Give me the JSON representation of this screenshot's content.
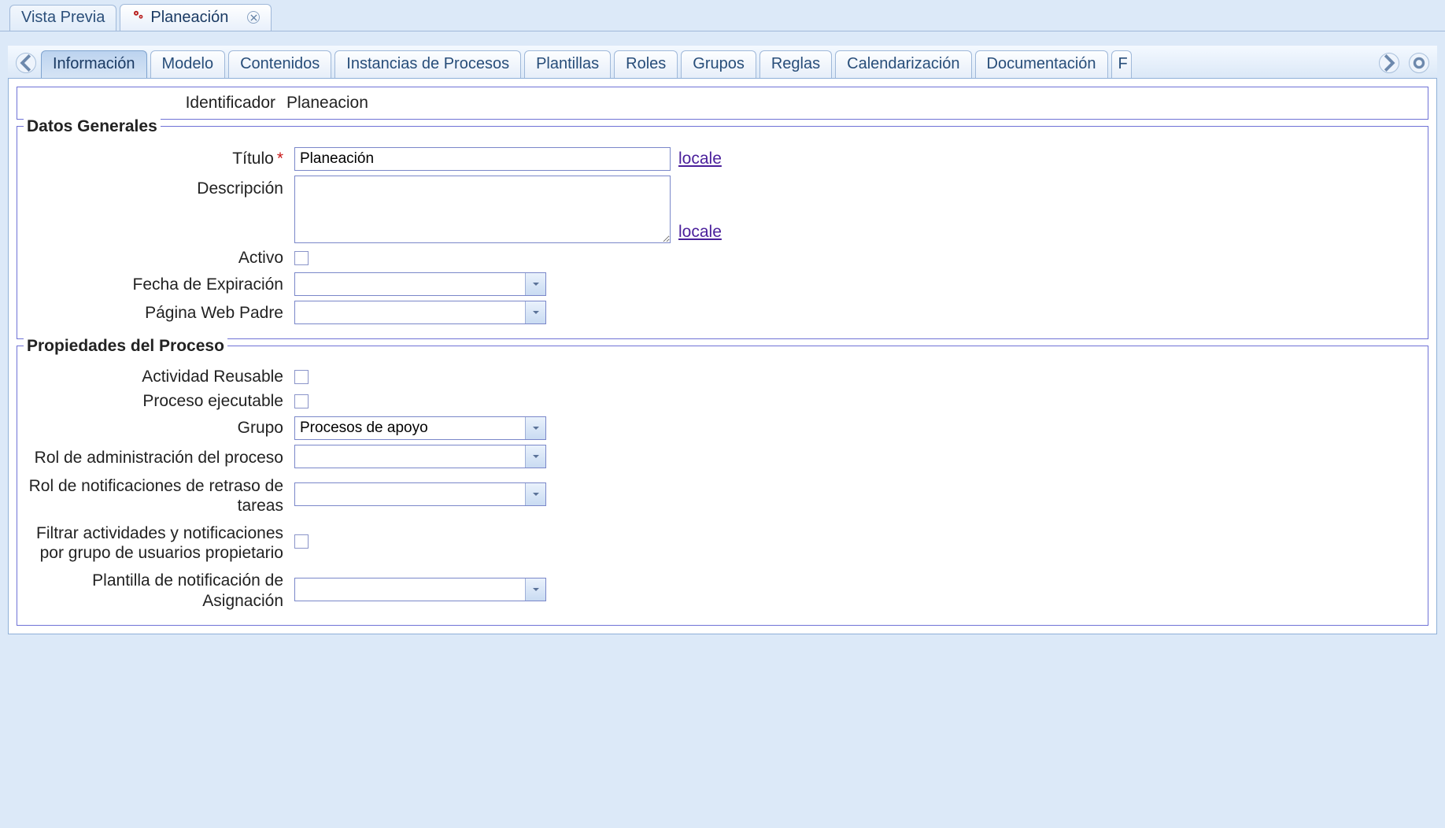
{
  "doc_tabs": {
    "preview": "Vista Previa",
    "planeacion": "Planeación"
  },
  "inner_tabs": {
    "informacion": "Información",
    "modelo": "Modelo",
    "contenidos": "Contenidos",
    "instancias": "Instancias de Procesos",
    "plantillas": "Plantillas",
    "roles": "Roles",
    "grupos": "Grupos",
    "reglas": "Reglas",
    "calendarizacion": "Calendarización",
    "documentacion": "Documentación",
    "partial": "F"
  },
  "identificador": {
    "label": "Identificador",
    "value": "Planeacion"
  },
  "datos_generales": {
    "legend": "Datos Generales",
    "titulo_label": "Título",
    "titulo_value": "Planeación",
    "titulo_locale": "locale",
    "descripcion_label": "Descripción",
    "descripcion_value": "",
    "descripcion_locale": "locale",
    "activo_label": "Activo",
    "fecha_expiracion_label": "Fecha de Expiración",
    "fecha_expiracion_value": "",
    "pagina_padre_label": "Página Web Padre",
    "pagina_padre_value": ""
  },
  "propiedades_proceso": {
    "legend": "Propiedades del Proceso",
    "actividad_reusable_label": "Actividad Reusable",
    "proceso_ejecutable_label": "Proceso ejecutable",
    "grupo_label": "Grupo",
    "grupo_value": "Procesos de apoyo",
    "rol_admin_label": "Rol de administración del proceso",
    "rol_admin_value": "",
    "rol_notif_label": "Rol de notificaciones de retraso de tareas",
    "rol_notif_value": "",
    "filtrar_label": "Filtrar actividades y notificaciones por grupo de usuarios propietario",
    "plantilla_notif_label": "Plantilla de notificación de Asignación",
    "plantilla_notif_value": ""
  }
}
